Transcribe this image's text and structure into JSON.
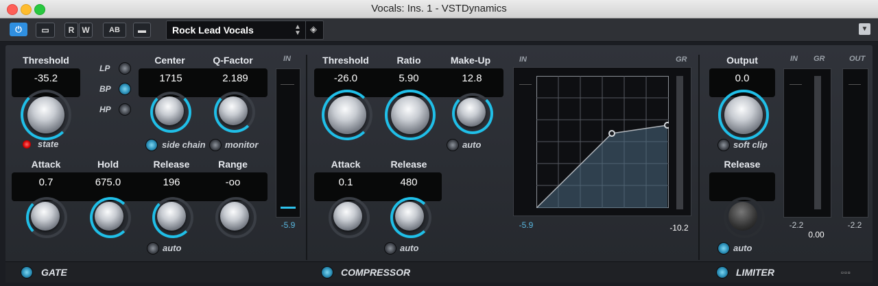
{
  "window": {
    "title": "Vocals: Ins. 1 - VSTDynamics"
  },
  "toolbar": {
    "preset_name": "Rock Lead Vocals",
    "rw_r": "R",
    "rw_w": "W",
    "ab_label": "AB"
  },
  "gate": {
    "threshold_label": "Threshold",
    "threshold_value": "-35.2",
    "lp": "LP",
    "bp": "BP",
    "hp": "HP",
    "center_label": "Center",
    "center_value": "1715",
    "qfactor_label": "Q-Factor",
    "qfactor_value": "2.189",
    "state_label": "state",
    "side_chain_label": "side chain",
    "monitor_label": "monitor",
    "attack_label": "Attack",
    "attack_value": "0.7",
    "hold_label": "Hold",
    "hold_value": "675.0",
    "release_label": "Release",
    "release_value": "196",
    "range_label": "Range",
    "range_value": "-oo",
    "auto_label": "auto",
    "footer": "GATE",
    "meter_in_label": "IN",
    "meter_value": "-5.9"
  },
  "compressor": {
    "threshold_label": "Threshold",
    "threshold_value": "-26.0",
    "ratio_label": "Ratio",
    "ratio_value": "5.90",
    "makeup_label": "Make-Up",
    "makeup_value": "12.8",
    "auto_makeup_label": "auto",
    "attack_label": "Attack",
    "attack_value": "0.1",
    "release_label": "Release",
    "release_value": "480",
    "auto_release_label": "auto",
    "footer": "COMPRESSOR",
    "graph_in_label": "IN",
    "graph_gr_label": "GR",
    "graph_in_value": "-5.9",
    "graph_gr_value": "-10.2"
  },
  "limiter": {
    "output_label": "Output",
    "output_value": "0.0",
    "soft_clip_label": "soft clip",
    "release_label": "Release",
    "auto_label": "auto",
    "footer": "LIMITER",
    "in_label": "IN",
    "gr_label": "GR",
    "out_label": "OUT",
    "in_value": "-2.2",
    "gr_value": "0.00",
    "out_value": "-2.2"
  },
  "colors": {
    "accent": "#20bfe8",
    "panel": "#2b2e34",
    "led": "#d40000"
  }
}
